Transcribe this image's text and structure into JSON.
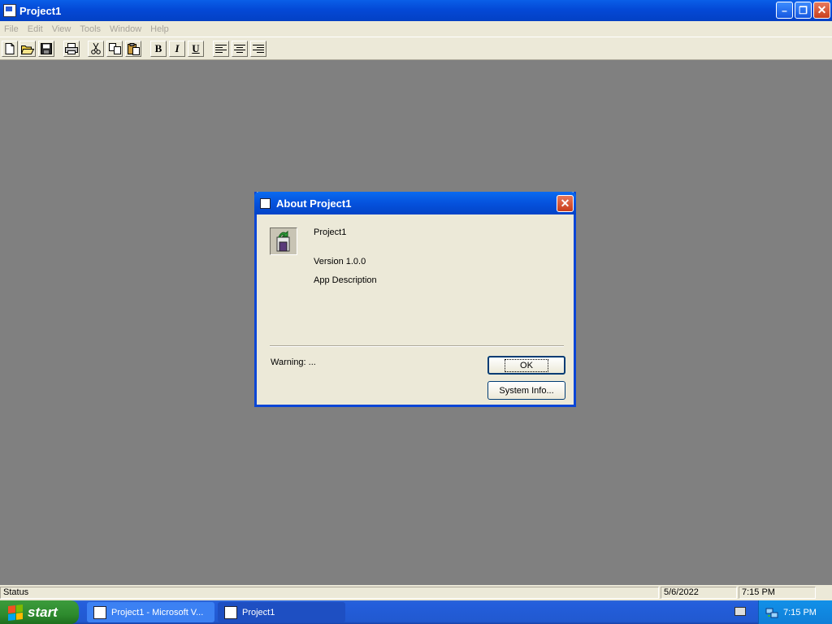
{
  "window": {
    "title": "Project1",
    "minimize_glyph": "–",
    "restore_glyph": "❐",
    "close_glyph": "✕"
  },
  "menu": {
    "items": [
      "File",
      "Edit",
      "View",
      "Tools",
      "Window",
      "Help"
    ]
  },
  "toolbar": {
    "buttons": [
      "new-document-icon",
      "open-folder-icon",
      "save-disk-icon",
      "print-icon",
      "cut-icon",
      "copy-icon",
      "paste-icon",
      "bold-button",
      "italic-button",
      "underline-button",
      "align-left-icon",
      "align-center-icon",
      "align-right-icon"
    ],
    "bold_label": "B",
    "italic_label": "I",
    "underline_label": "U"
  },
  "dialog": {
    "title": "About Project1",
    "close_glyph": "✕",
    "app_name": "Project1",
    "version": "Version 1.0.0",
    "description": "App Description",
    "warning": "Warning: ...",
    "ok_label": "OK",
    "sysinfo_label": "System Info..."
  },
  "statusbar": {
    "status": "Status",
    "date": "5/6/2022",
    "time": "7:15 PM"
  },
  "taskbar": {
    "start_label": "start",
    "tasks": [
      {
        "label": "Project1 - Microsoft V..."
      },
      {
        "label": "Project1"
      }
    ],
    "clock": "7:15 PM"
  },
  "colors": {
    "titlebar": "#0449D6",
    "workspace": "#808080",
    "face": "#ECE9D8",
    "taskbar": "#245EDC",
    "start": "#2E8B2E"
  }
}
